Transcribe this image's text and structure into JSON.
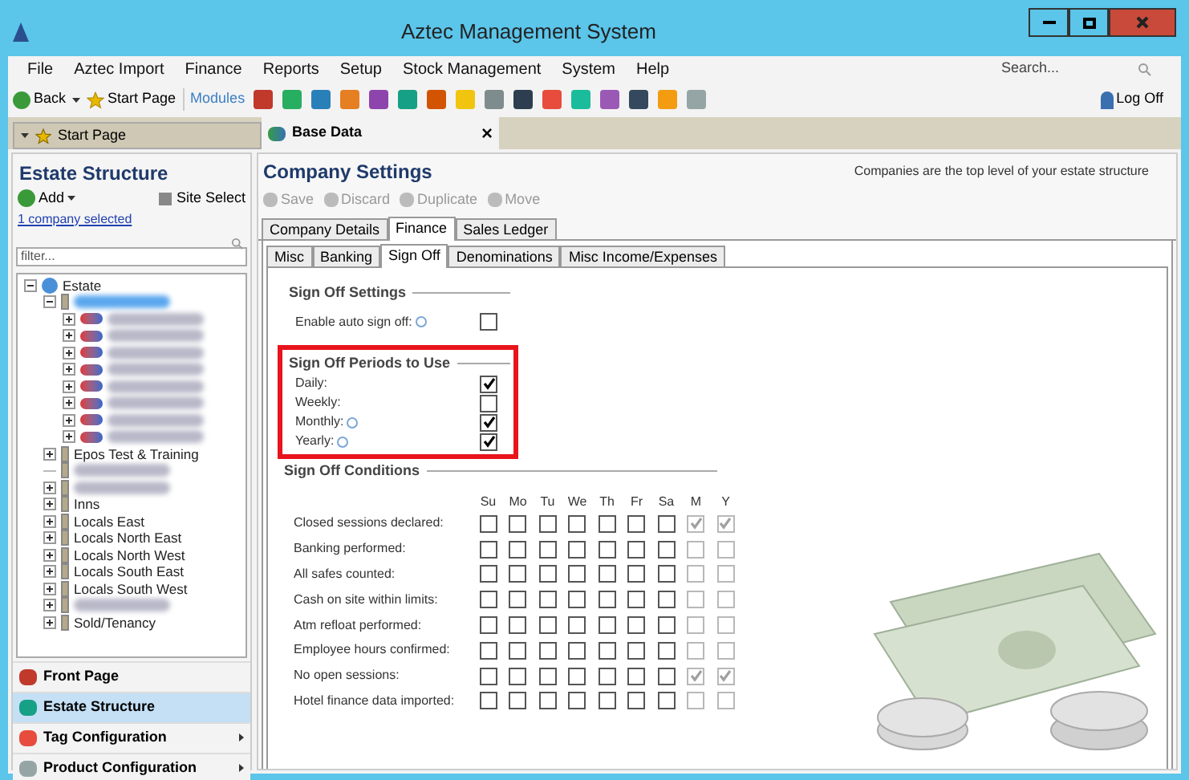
{
  "window": {
    "title": "Aztec Management System"
  },
  "menu": [
    "File",
    "Aztec Import",
    "Finance",
    "Reports",
    "Setup",
    "Stock Management",
    "System",
    "Help"
  ],
  "search": {
    "placeholder": "Search..."
  },
  "toolbar": {
    "back": "Back",
    "start_page": "Start Page",
    "modules": "Modules",
    "log_off": "Log Off"
  },
  "doc_tabs": [
    {
      "label": "Start Page",
      "selected": false
    },
    {
      "label": "Base Data",
      "selected": true,
      "close": "×"
    }
  ],
  "sidebar": {
    "title": "Estate Structure",
    "add": "Add",
    "site_select": "Site Select",
    "selection_link": "1 company selected",
    "filter": {
      "placeholder": "filter..."
    },
    "tree": [
      {
        "label": "Estate",
        "expanded": true,
        "children": [
          {
            "kind": "redacted",
            "selected": true,
            "expanded": true,
            "children": [
              {
                "kind": "redacted",
                "expanded": false
              },
              {
                "kind": "redacted",
                "expanded": false
              },
              {
                "kind": "redacted",
                "expanded": false
              },
              {
                "kind": "redacted",
                "expanded": false
              },
              {
                "kind": "redacted",
                "expanded": false
              },
              {
                "kind": "redacted",
                "expanded": false
              },
              {
                "kind": "redacted",
                "expanded": false
              },
              {
                "kind": "redacted",
                "expanded": false
              }
            ]
          },
          {
            "label": "Epos Test & Training",
            "expanded": false
          },
          {
            "kind": "redacted"
          },
          {
            "kind": "redacted",
            "expanded": false
          },
          {
            "label": "Inns",
            "expanded": false
          },
          {
            "label": "Locals East",
            "expanded": false
          },
          {
            "label": "Locals North East",
            "expanded": false
          },
          {
            "label": "Locals North West",
            "expanded": false
          },
          {
            "label": "Locals South East",
            "expanded": false
          },
          {
            "label": "Locals South West",
            "expanded": false
          },
          {
            "kind": "redacted",
            "expanded": false
          },
          {
            "label": "Sold/Tenancy",
            "expanded": false
          }
        ]
      }
    ],
    "nav": [
      {
        "label": "Front Page",
        "selected": false,
        "submenu": false
      },
      {
        "label": "Estate Structure",
        "selected": true,
        "submenu": false
      },
      {
        "label": "Tag Configuration",
        "selected": false,
        "submenu": true
      },
      {
        "label": "Product Configuration",
        "selected": false,
        "submenu": true
      }
    ]
  },
  "main": {
    "title": "Company Settings",
    "hint": "Companies are the top level of your estate structure",
    "actions": [
      {
        "label": "Save",
        "disabled": true
      },
      {
        "label": "Discard",
        "disabled": true
      },
      {
        "label": "Duplicate",
        "disabled": true
      },
      {
        "label": "Move",
        "disabled": true
      }
    ],
    "tabs": [
      {
        "label": "Company Details",
        "selected": false
      },
      {
        "label": "Finance",
        "selected": true
      },
      {
        "label": "Sales Ledger",
        "selected": false
      }
    ],
    "subtabs": [
      {
        "label": "Misc",
        "selected": false
      },
      {
        "label": "Banking",
        "selected": false
      },
      {
        "label": "Sign Off",
        "selected": true
      },
      {
        "label": "Denominations",
        "selected": false
      },
      {
        "label": "Misc Income/Expenses",
        "selected": false
      }
    ],
    "settings": {
      "title": "Sign Off Settings",
      "items": [
        {
          "label": "Enable auto sign off:",
          "info": true,
          "checked": false
        }
      ]
    },
    "periods": {
      "title": "Sign Off Periods to Use",
      "highlighted": true,
      "items": [
        {
          "label": "Daily:",
          "info": false,
          "checked": true
        },
        {
          "label": "Weekly:",
          "info": false,
          "checked": false
        },
        {
          "label": "Monthly:",
          "info": true,
          "checked": true
        },
        {
          "label": "Yearly:",
          "info": true,
          "checked": true
        }
      ]
    },
    "conditions": {
      "title": "Sign Off Conditions",
      "columns": [
        "Su",
        "Mo",
        "Tu",
        "We",
        "Th",
        "Fr",
        "Sa",
        "M",
        "Y"
      ],
      "rows": [
        {
          "label": "Closed sessions declared:",
          "checks": [
            false,
            false,
            false,
            false,
            false,
            false,
            false,
            true,
            true
          ]
        },
        {
          "label": "Banking performed:",
          "checks": [
            false,
            false,
            false,
            false,
            false,
            false,
            false,
            false,
            false
          ]
        },
        {
          "label": "All safes counted:",
          "checks": [
            false,
            false,
            false,
            false,
            false,
            false,
            false,
            false,
            false
          ]
        },
        {
          "label": "Cash on site within limits:",
          "checks": [
            false,
            false,
            false,
            false,
            false,
            false,
            false,
            false,
            false
          ]
        },
        {
          "label": "Atm refloat performed:",
          "checks": [
            false,
            false,
            false,
            false,
            false,
            false,
            false,
            false,
            false
          ]
        },
        {
          "label": "Employee hours confirmed:",
          "checks": [
            false,
            false,
            false,
            false,
            false,
            false,
            false,
            false,
            false
          ]
        },
        {
          "label": "No open sessions:",
          "checks": [
            false,
            false,
            false,
            false,
            false,
            false,
            false,
            true,
            true
          ]
        },
        {
          "label": "Hotel finance data imported:",
          "checks": [
            false,
            false,
            false,
            false,
            false,
            false,
            false,
            false,
            false
          ]
        }
      ]
    }
  }
}
